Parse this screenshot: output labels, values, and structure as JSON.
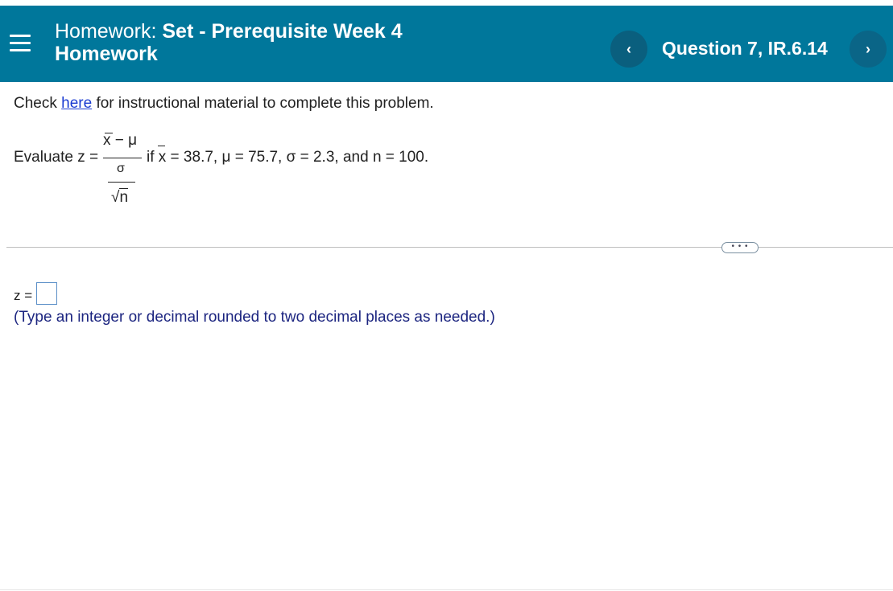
{
  "header": {
    "title_label": "Homework:",
    "title_set_line1": "Set - Prerequisite Week 4",
    "title_set_line2": "Homework",
    "prev_symbol": "‹",
    "next_symbol": "›",
    "question_label": "Question 7, IR.6.14"
  },
  "instructions": {
    "check_prefix": "Check ",
    "check_link": "here",
    "check_suffix": " for instructional material to complete this problem."
  },
  "problem": {
    "evaluate_label": "Evaluate z =",
    "numerator_x": "x",
    "numerator_rest": " − μ",
    "denominator_sigma": "σ",
    "radical": "√",
    "radicand": "n",
    "condition_if": "if ",
    "condition_x": "x",
    "condition_rest": " = 38.7, μ = 75.7, σ = 2.3, and n = 100."
  },
  "answer": {
    "z_label": "z =",
    "z_value": "",
    "hint": "(Type an integer or decimal rounded to two decimal places as needed.)"
  },
  "more_button": "• • •",
  "colors": {
    "header_bg": "#00779b",
    "nav_button_bg": "#0a5f7e",
    "link": "#1a3bd1",
    "hint_text": "#1c2580"
  }
}
